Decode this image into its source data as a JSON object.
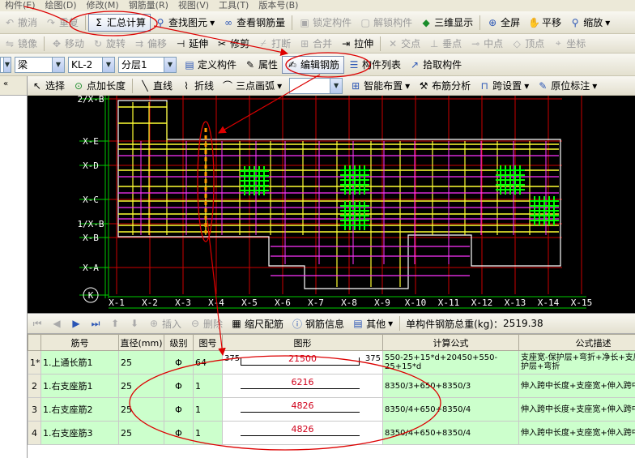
{
  "menubar": [
    "构件(E)",
    "绘图(D)",
    "修改(M)",
    "钢筋量(R)",
    "视图(V)",
    "工具(T)",
    "版本号(B)"
  ],
  "toolbar1": {
    "undo": "撤消",
    "redo": "重复",
    "summary_calc": "汇总计算",
    "find_element": "查找图元",
    "view_rebar_qty": "查看钢筋量",
    "lock_element": "锁定构件",
    "unlock_element": "解锁构件",
    "view_3d": "三维显示",
    "fullscreen": "全屏",
    "pan": "平移",
    "zoom": "缩放"
  },
  "toolbar2": {
    "mirror": "镜像",
    "move": "移动",
    "rotate": "旋转",
    "offset": "偏移",
    "extend": "延伸",
    "trim": "修剪",
    "break": "打断",
    "merge": "合并",
    "stretch": "拉伸",
    "snap_intersection": "交点",
    "snap_perpendicular": "垂点",
    "snap_midpoint": "中点",
    "snap_vertex": "顶点",
    "snap_coordinate": "坐标"
  },
  "toolbar3": {
    "category": "梁",
    "element": "KL-2",
    "floor": "分层1",
    "define_element": "定义构件",
    "properties": "属性",
    "edit_rebar": "编辑钢筋",
    "element_list": "构件列表",
    "pick_element": "拾取构件"
  },
  "toolbar4": {
    "select": "选择",
    "point_length": "点加长度",
    "line": "直线",
    "polyline": "折线",
    "three_point_arc": "三点画弧",
    "smart_layout": "智能布置",
    "rebar_analysis": "布筋分析",
    "span_settings": "跨设置",
    "in_place_annotation": "原位标注"
  },
  "axes": {
    "rows": [
      "2/X-B",
      "X-E",
      "X-D",
      "X-C",
      "1/X-B",
      "X-B",
      "X-A",
      "K"
    ],
    "cols": [
      "X-1",
      "X-2",
      "X-3",
      "X-4",
      "X-5",
      "X-6",
      "X-7",
      "X-8",
      "X-9",
      "X-10",
      "X-11",
      "X-12",
      "X-13",
      "X-14",
      "X-15"
    ]
  },
  "grid_toolbar": {
    "insert": "插入",
    "delete": "删除",
    "scale_rebar": "缩尺配筋",
    "rebar_info": "钢筋信息",
    "other": "其他",
    "total_weight_label": "单构件钢筋总重(kg)：",
    "total_weight": "2519.38"
  },
  "table": {
    "headers": [
      "筋号",
      "直径(mm)",
      "级别",
      "图号",
      "图形",
      "计算公式",
      "公式描述"
    ],
    "rows": [
      {
        "num": "1*",
        "name": "1.上通长筋1",
        "dia": "25",
        "grade": "Φ",
        "fig": "64",
        "left": "375",
        "len": "21500",
        "right": "375",
        "formula": "550-25+15*d+20450+550-25+15*d",
        "desc": "支座宽-保护层+弯折+净长+支座宽-保护层+弯折"
      },
      {
        "num": "2",
        "name": "1.右支座筋1",
        "dia": "25",
        "grade": "Φ",
        "fig": "1",
        "left": "",
        "len": "6216",
        "right": "",
        "formula": "8350/3+650+8350/3",
        "desc": "伸入跨中长度+支座宽+伸入跨中长度"
      },
      {
        "num": "3",
        "name": "1.右支座筋2",
        "dia": "25",
        "grade": "Φ",
        "fig": "1",
        "left": "",
        "len": "4826",
        "right": "",
        "formula": "8350/4+650+8350/4",
        "desc": "伸入跨中长度+支座宽+伸入跨中长度"
      },
      {
        "num": "4",
        "name": "1.右支座筋3",
        "dia": "25",
        "grade": "Φ",
        "fig": "1",
        "left": "",
        "len": "4826",
        "right": "",
        "formula": "8350/4+650+8350/4",
        "desc": "伸入跨中长度+支座宽+伸入跨中长度"
      }
    ]
  },
  "colors": {
    "canvas_bg": "#000000",
    "axis_green": "#00cc00",
    "grid_red": "#cc0000",
    "rebar_yellow": "#ffff33",
    "rebar_magenta": "#ff33ff",
    "rebar_green": "#00ff00",
    "annotation_red": "#dd0000"
  }
}
